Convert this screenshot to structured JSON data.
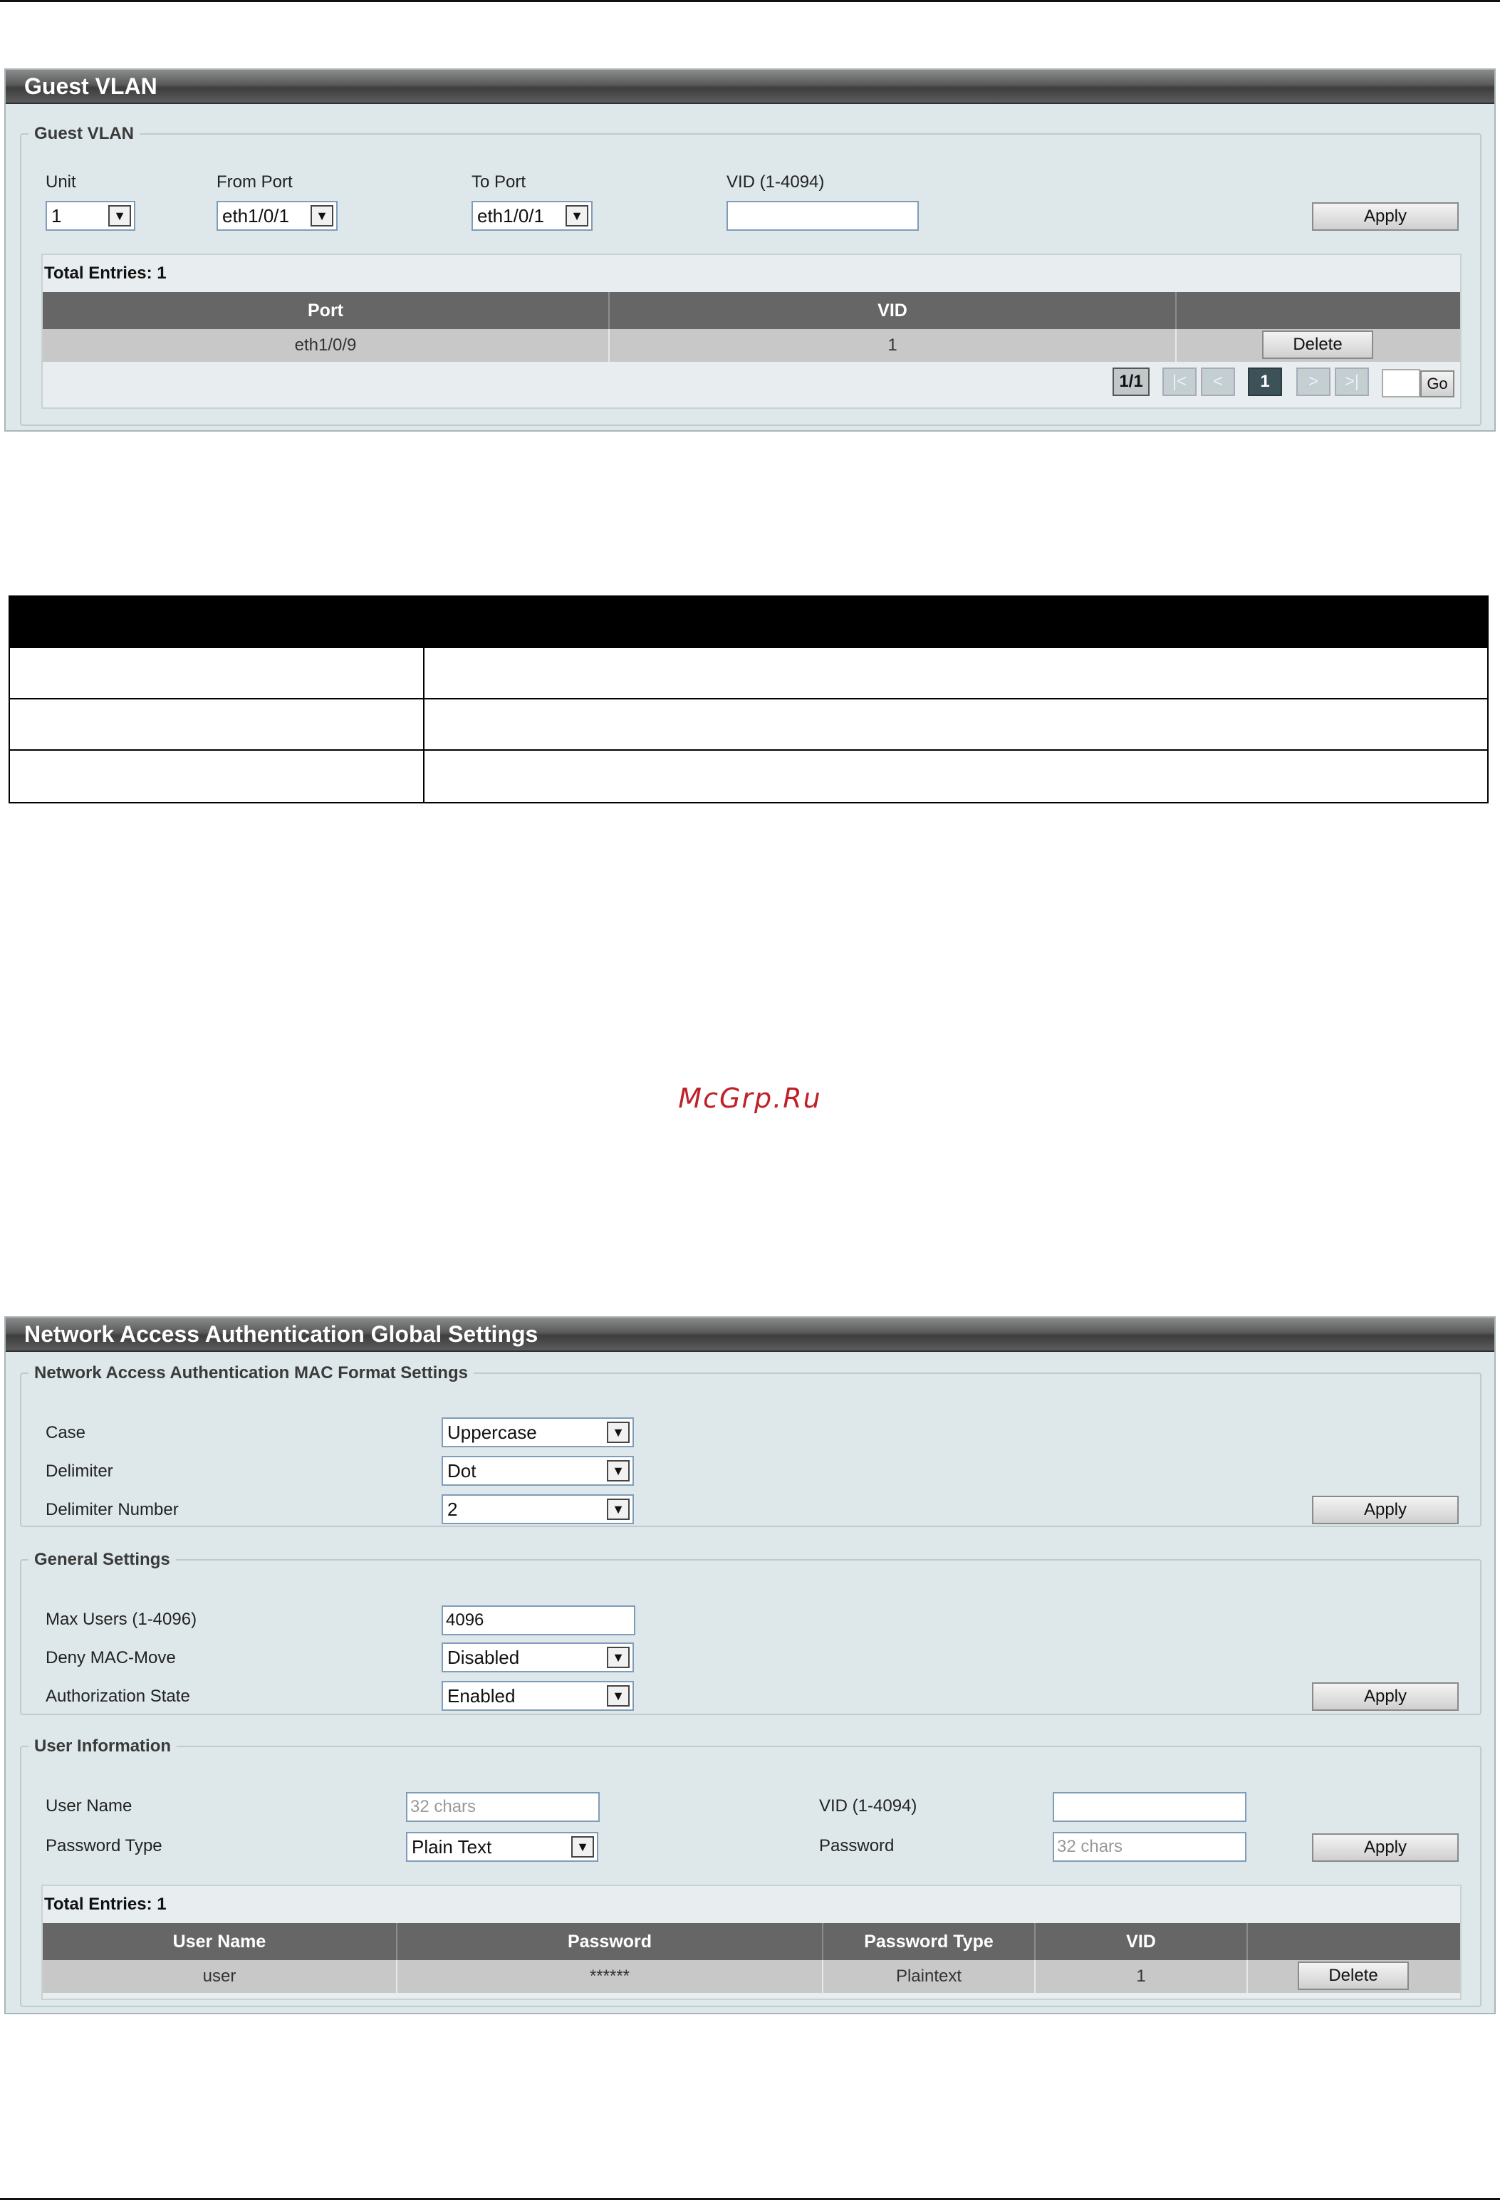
{
  "guest_vlan": {
    "title": "Guest VLAN",
    "group_legend": "Guest VLAN",
    "unit_label": "Unit",
    "unit_value": "1",
    "from_port_label": "From Port",
    "from_port_value": "eth1/0/1",
    "to_port_label": "To Port",
    "to_port_value": "eth1/0/1",
    "vid_label": "VID (1-4094)",
    "vid_value": "",
    "apply_label": "Apply",
    "total_entries": "Total Entries: 1",
    "columns": [
      "Port",
      "VID",
      ""
    ],
    "rows": [
      {
        "port": "eth1/0/9",
        "vid": "1",
        "action": "Delete"
      }
    ],
    "pager": {
      "page_info": "1/1",
      "first": "|<",
      "prev": "<",
      "current": "1",
      "next": ">",
      "last": ">|",
      "go_label": "Go",
      "go_value": ""
    }
  },
  "watermark": "McGrp.Ru",
  "naa": {
    "title": "Network Access Authentication Global Settings",
    "mac_format": {
      "legend": "Network Access Authentication MAC Format Settings",
      "case_label": "Case",
      "case_value": "Uppercase",
      "delimiter_label": "Delimiter",
      "delimiter_value": "Dot",
      "delimiter_number_label": "Delimiter Number",
      "delimiter_number_value": "2",
      "apply_label": "Apply"
    },
    "general": {
      "legend": "General Settings",
      "max_users_label": "Max Users (1-4096)",
      "max_users_value": "4096",
      "deny_mac_move_label": "Deny MAC-Move",
      "deny_mac_move_value": "Disabled",
      "authorization_state_label": "Authorization State",
      "authorization_state_value": "Enabled",
      "apply_label": "Apply"
    },
    "user_info": {
      "legend": "User Information",
      "user_name_label": "User Name",
      "user_name_placeholder": "32 chars",
      "vid_label": "VID (1-4094)",
      "vid_value": "",
      "password_type_label": "Password Type",
      "password_type_value": "Plain Text",
      "password_label": "Password",
      "password_placeholder": "32 chars",
      "apply_label": "Apply",
      "total_entries": "Total Entries: 1",
      "columns": [
        "User Name",
        "Password",
        "Password Type",
        "VID",
        ""
      ],
      "rows": [
        {
          "user_name": "user",
          "password": "******",
          "password_type": "Plaintext",
          "vid": "1",
          "action": "Delete"
        }
      ]
    }
  }
}
